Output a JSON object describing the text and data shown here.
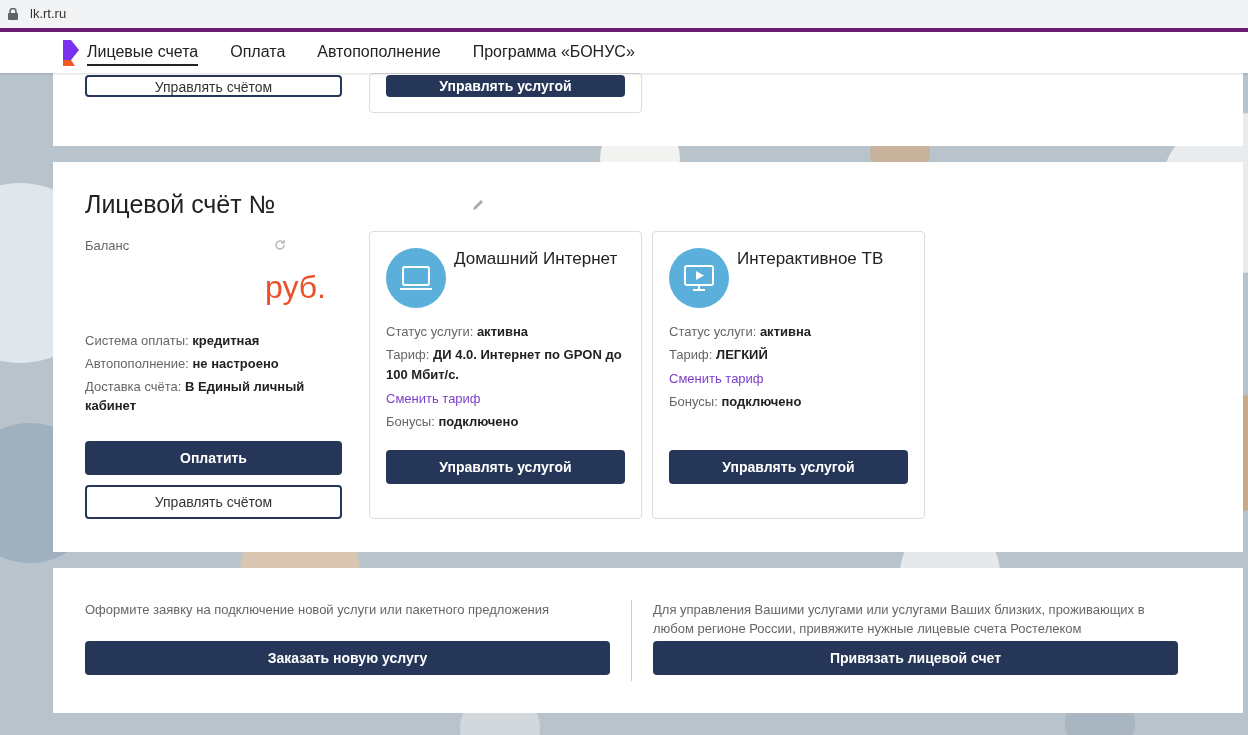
{
  "browser": {
    "url": "lk.rt.ru"
  },
  "nav": {
    "items": [
      {
        "label": "Лицевые счета",
        "selected": true
      },
      {
        "label": "Оплата",
        "selected": false
      },
      {
        "label": "Автопополнение",
        "selected": false
      },
      {
        "label": "Программа «БОНУС»",
        "selected": false
      }
    ]
  },
  "previous_account": {
    "account_button": "Управлять счётом",
    "service_button": "Управлять услугой"
  },
  "account": {
    "title": "Лицевой счёт №",
    "balance_label": "Баланс",
    "currency": "руб.",
    "details": [
      {
        "label": "Система оплаты:",
        "value": "кредитная"
      },
      {
        "label": "Автопополнение:",
        "value": "не настроено"
      },
      {
        "label": "Доставка счёта:",
        "value": "В Единый личный кабинет"
      }
    ],
    "pay_button": "Оплатить",
    "manage_button": "Управлять счётом",
    "services": [
      {
        "kind": "internet",
        "name": "Домашний Интернет",
        "status_label": "Статус услуги:",
        "status": "активна",
        "tariff_label": "Тариф:",
        "tariff": "ДИ 4.0. Интернет по GPON до 100 Мбит/с.",
        "change_link": "Сменить тариф",
        "bonus_label": "Бонусы:",
        "bonus": "подключено",
        "button": "Управлять услугой"
      },
      {
        "kind": "tv",
        "name": "Интерактивное ТВ",
        "status_label": "Статус услуги:",
        "status": "активна",
        "tariff_label": "Тариф:",
        "tariff": "ЛЕГКИЙ",
        "change_link": "Сменить тариф",
        "bonus_label": "Бонусы:",
        "bonus": "подключено",
        "button": "Управлять услугой"
      }
    ]
  },
  "actions": [
    {
      "text": "Оформите заявку на подключение новой услуги или пакетного предложения",
      "button": "Заказать новую услугу"
    },
    {
      "text": "Для управления Вашими услугами или услугами Ваших близких, проживающих в любом регионе России, привяжите нужные лицевые счета Ростелеком",
      "button": "Привязать лицевой счет"
    }
  ]
}
